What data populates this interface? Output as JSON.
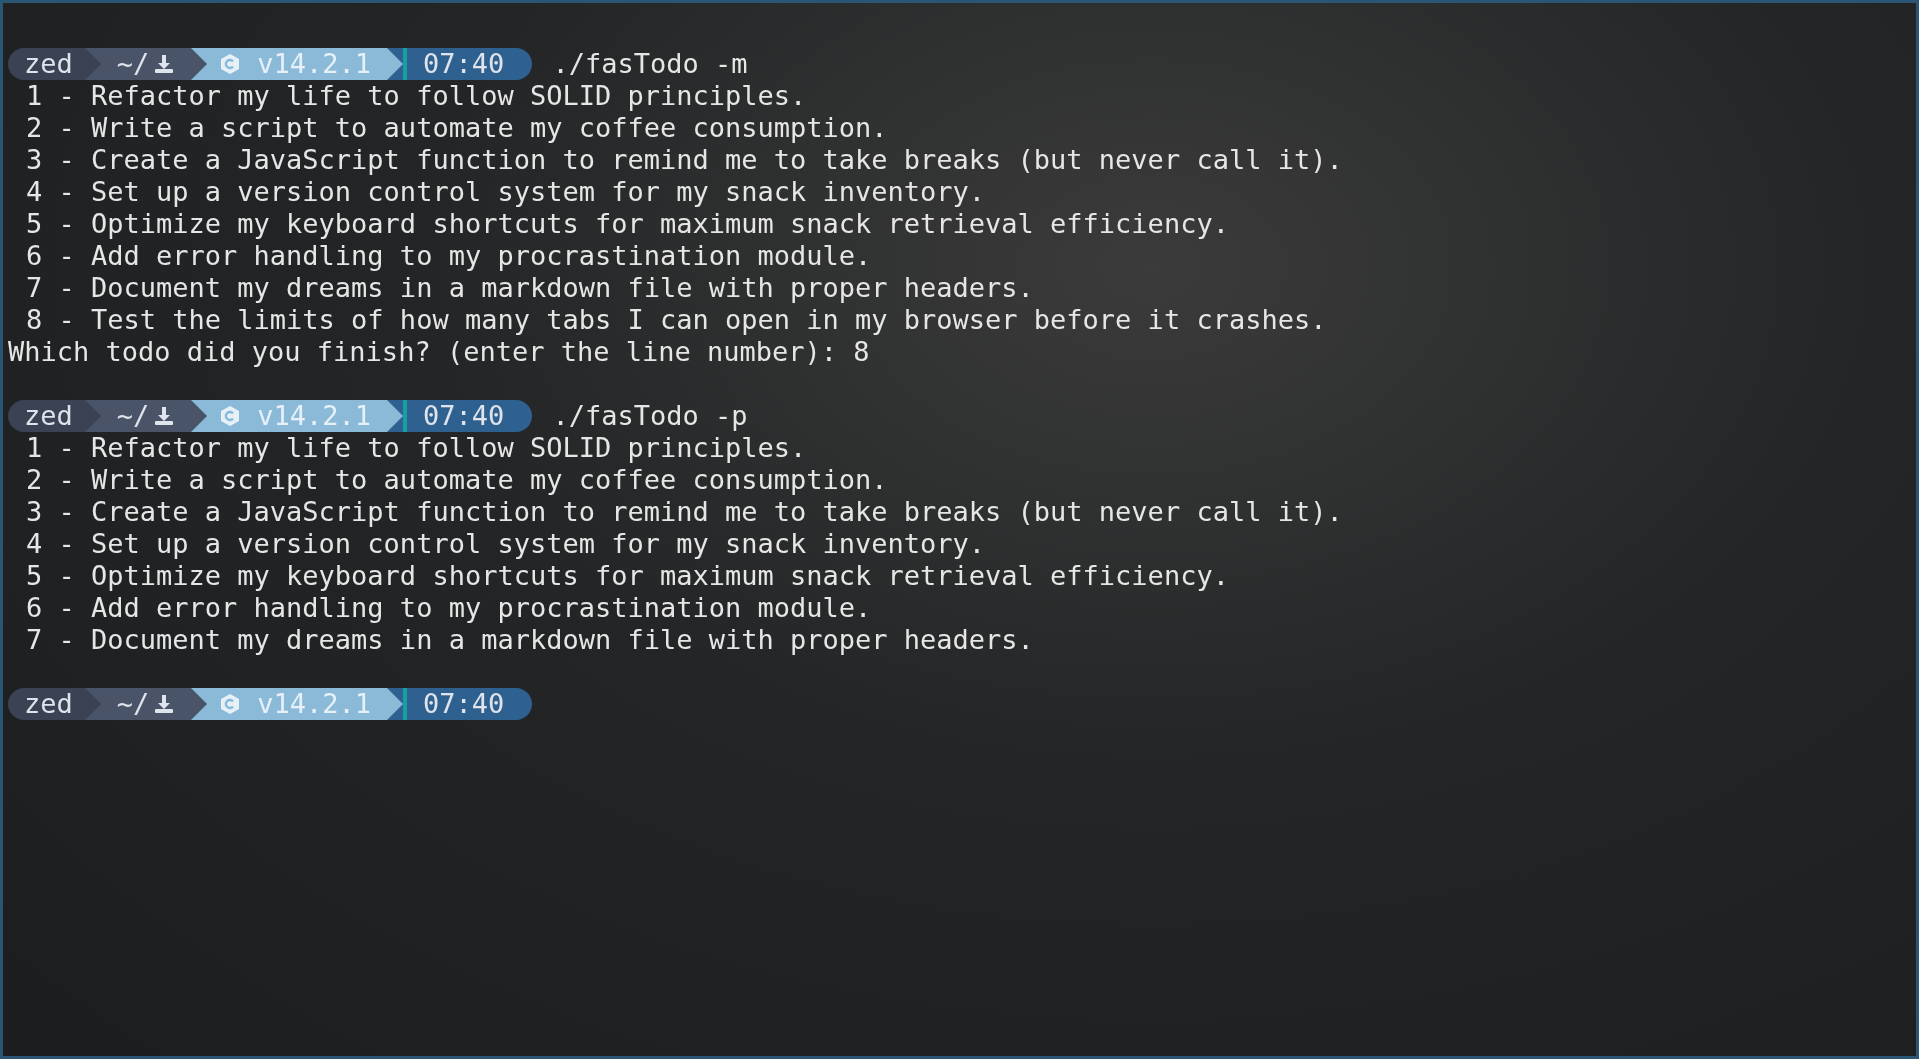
{
  "sessions": [
    {
      "prompt": {
        "user": "zed",
        "dir": "~/",
        "runtime": "v14.2.1",
        "time": "07:40"
      },
      "command": "./fasTodo -m",
      "lines": [
        "1 - Refactor my life to follow SOLID principles.",
        "2 - Write a script to automate my coffee consumption.",
        "3 - Create a JavaScript function to remind me to take breaks (but never call it).",
        "4 - Set up a version control system for my snack inventory.",
        "5 - Optimize my keyboard shortcuts for maximum snack retrieval efficiency.",
        "6 - Add error handling to my procrastination module.",
        "7 - Document my dreams in a markdown file with proper headers.",
        "8 - Test the limits of how many tabs I can open in my browser before it crashes."
      ],
      "question": "Which todo did you finish? (enter the line number): 8"
    },
    {
      "prompt": {
        "user": "zed",
        "dir": "~/",
        "runtime": "v14.2.1",
        "time": "07:40"
      },
      "command": "./fasTodo -p",
      "lines": [
        "1 - Refactor my life to follow SOLID principles.",
        "2 - Write a script to automate my coffee consumption.",
        "3 - Create a JavaScript function to remind me to take breaks (but never call it).",
        "4 - Set up a version control system for my snack inventory.",
        "5 - Optimize my keyboard shortcuts for maximum snack retrieval efficiency.",
        "6 - Add error handling to my procrastination module.",
        "7 - Document my dreams in a markdown file with proper headers."
      ]
    },
    {
      "prompt": {
        "user": "zed",
        "dir": "~/",
        "runtime": "v14.2.1",
        "time": "07:40"
      }
    }
  ]
}
